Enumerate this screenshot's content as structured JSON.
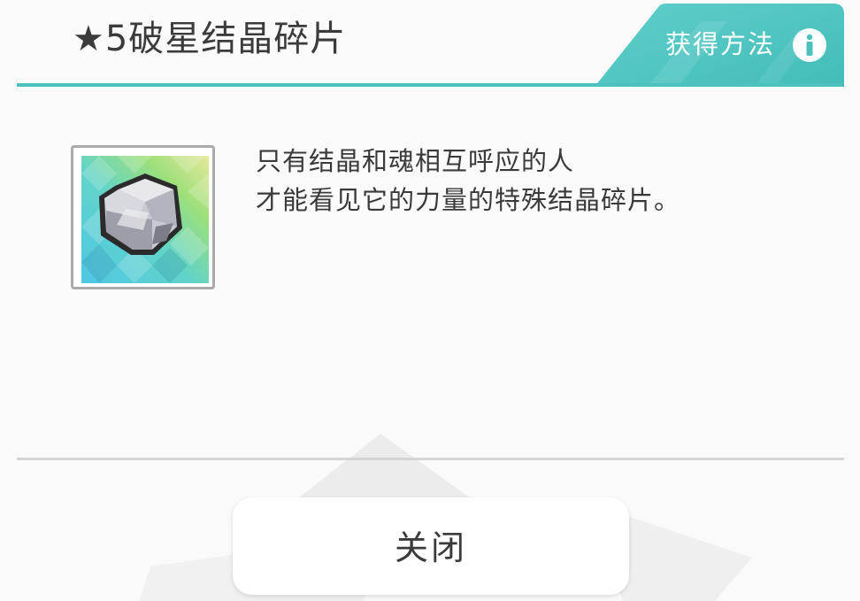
{
  "dialog": {
    "title": "★5破星结晶碎片",
    "acquire_tab_label": "获得方法",
    "description_lines": [
      "只有结晶和魂相互呼应的人",
      "才能看见它的力量的特殊结晶碎片。"
    ],
    "close_label": "关闭"
  },
  "icons": {
    "info": "info-icon",
    "item": "crystal-fragment-icon"
  },
  "colors": {
    "accent": "#4dc1bd",
    "accent_light": "#7fd6d3",
    "text": "#3b3b3b",
    "frame": "#a9abab"
  }
}
